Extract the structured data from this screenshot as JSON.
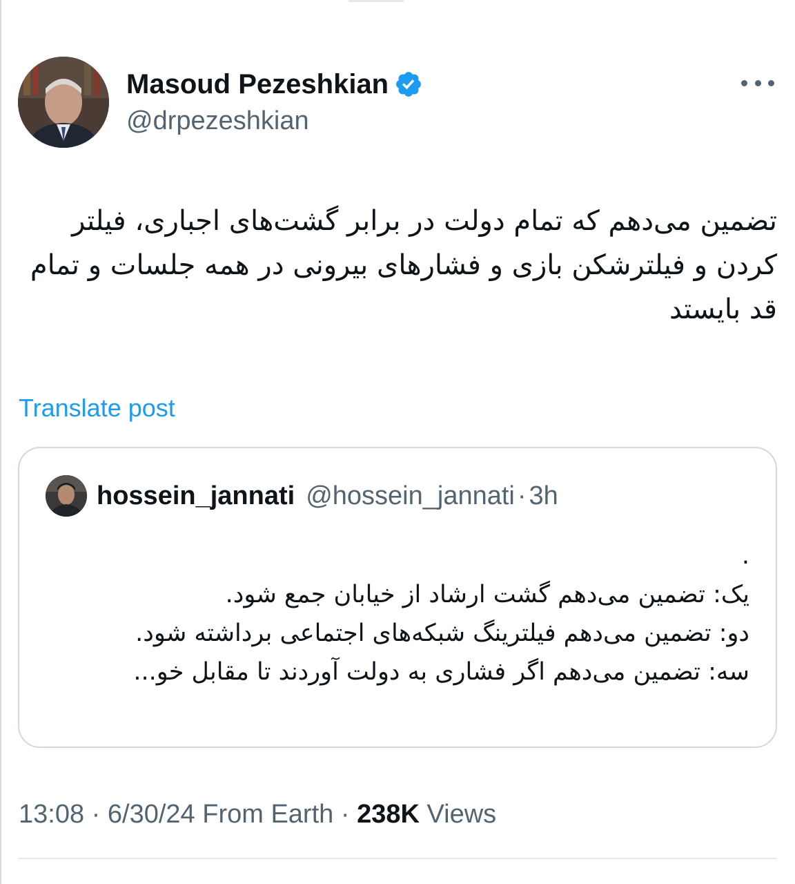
{
  "author": {
    "display_name": "Masoud Pezeshkian",
    "handle": "@drpezeshkian",
    "verified_icon": "verified-badge-icon"
  },
  "post": {
    "text": "تضمین می‌دهم که تمام دولت در برابر  گشت‌های اجباری، فیلتر کردن و فیلترشکن بازی و فشارهای بیرونی در همه جلسات و تمام قد بایستد",
    "translate_label": "Translate post"
  },
  "quote": {
    "display_name": "hossein_jannati",
    "handle": "@hossein_jannati",
    "separator": "·",
    "time": "3h",
    "lines": [
      ".",
      "یک: تضمین می‌دهم گشت ارشاد از خیابان جمع شود.",
      "دو: تضمین می‌دهم فیلترینگ شبکه‌های اجتماعی برداشته شود.",
      "سه: تضمین می‌دهم اگر فشاری به دولت آوردند تا مقابل خو..."
    ]
  },
  "meta": {
    "time": "13:08",
    "sep1": " · ",
    "date": "6/30/24",
    "source": " From Earth",
    "sep2": " · ",
    "views_count": "238K",
    "views_label": " Views"
  },
  "colors": {
    "accent": "#1d9bf0",
    "text_primary": "#0f1419",
    "text_secondary": "#536471",
    "border": "#cfd9de"
  }
}
